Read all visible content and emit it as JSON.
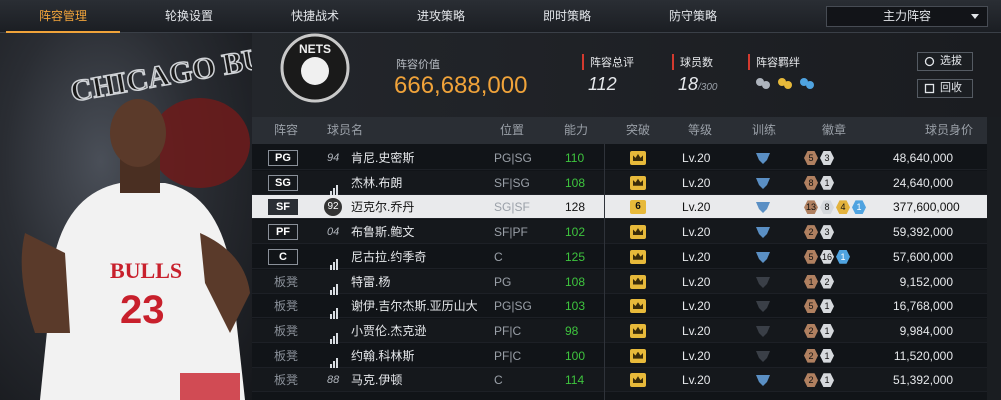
{
  "tabs": [
    "阵容管理",
    "轮换设置",
    "快捷战术",
    "进攻策略",
    "即时策略",
    "防守策略"
  ],
  "lineup_select": "主力阵容",
  "art": {
    "team_text": "CHICAGO BULLS",
    "jersey_text": "BULLS",
    "jersey_number": "23"
  },
  "team_logo_text": "NETS",
  "roster_value": {
    "label": "阵容价值",
    "value": "666,688,000"
  },
  "stats": [
    {
      "label": "阵容总评",
      "value": "112",
      "sub": ""
    },
    {
      "label": "球员数",
      "value": "18",
      "sub": "/300"
    },
    {
      "label": "阵容羁绊",
      "value": "",
      "sub": ""
    }
  ],
  "buttons": {
    "pick": "选拔",
    "back": "回收"
  },
  "colors": {
    "accent": "#f0a33a",
    "ability": "#3ec43e",
    "selected_row": "#e9eaec",
    "stat_bar": "#d33a2f"
  },
  "columns": [
    "阵容",
    "球员名",
    "位置",
    "能力",
    "突破",
    "等级",
    "训练",
    "徽章",
    "球员身价"
  ],
  "players": [
    {
      "slot": "PG",
      "bench": false,
      "jersey": "94",
      "name": "肯尼.史密斯",
      "position": "PG|SG",
      "ability": "110",
      "breakthrough": "",
      "level": "Lv.20",
      "medals": [
        {
          "c": "bronze",
          "n": "5"
        },
        {
          "c": "silver",
          "n": "3"
        }
      ],
      "value": "48,640,000"
    },
    {
      "slot": "SG",
      "bench": false,
      "jersey": "",
      "name": "杰林.布朗",
      "position": "SF|SG",
      "ability": "108",
      "breakthrough": "",
      "level": "Lv.20",
      "medals": [
        {
          "c": "bronze",
          "n": "8"
        },
        {
          "c": "silver",
          "n": "1"
        }
      ],
      "value": "24,640,000"
    },
    {
      "slot": "SF",
      "bench": false,
      "jersey": "92",
      "name": "迈克尔.乔丹",
      "position": "SG|SF",
      "ability": "128",
      "breakthrough": "6",
      "level": "Lv.20",
      "medals": [
        {
          "c": "bronze",
          "n": "13"
        },
        {
          "c": "silver",
          "n": "8"
        },
        {
          "c": "gold",
          "n": "4"
        },
        {
          "c": "blue",
          "n": "1"
        }
      ],
      "value": "377,600,000"
    },
    {
      "slot": "PF",
      "bench": false,
      "jersey": "04",
      "name": "布鲁斯.鲍文",
      "position": "SF|PF",
      "ability": "102",
      "breakthrough": "",
      "level": "Lv.20",
      "medals": [
        {
          "c": "bronze",
          "n": "2"
        },
        {
          "c": "silver",
          "n": "3"
        }
      ],
      "value": "59,392,000"
    },
    {
      "slot": "C",
      "bench": false,
      "jersey": "",
      "name": "尼古拉.约季奇",
      "position": "C",
      "ability": "125",
      "breakthrough": "",
      "level": "Lv.20",
      "medals": [
        {
          "c": "bronze",
          "n": "5"
        },
        {
          "c": "silver",
          "n": "16"
        },
        {
          "c": "blue",
          "n": "1"
        }
      ],
      "value": "57,600,000"
    },
    {
      "slot": "板凳",
      "bench": true,
      "jersey": "",
      "name": "特雷.杨",
      "position": "PG",
      "ability": "108",
      "breakthrough": "",
      "level": "Lv.20",
      "medals": [
        {
          "c": "bronze",
          "n": "1"
        },
        {
          "c": "silver",
          "n": "2"
        }
      ],
      "value": "9,152,000"
    },
    {
      "slot": "板凳",
      "bench": true,
      "jersey": "",
      "name": "谢伊.吉尔杰斯.亚历山大",
      "position": "PG|SG",
      "ability": "103",
      "breakthrough": "",
      "level": "Lv.20",
      "medals": [
        {
          "c": "bronze",
          "n": "5"
        },
        {
          "c": "silver",
          "n": "1"
        }
      ],
      "value": "16,768,000"
    },
    {
      "slot": "板凳",
      "bench": true,
      "jersey": "",
      "name": "小贾伦.杰克逊",
      "position": "PF|C",
      "ability": "98",
      "breakthrough": "",
      "level": "Lv.20",
      "medals": [
        {
          "c": "bronze",
          "n": "2"
        },
        {
          "c": "silver",
          "n": "1"
        }
      ],
      "value": "9,984,000"
    },
    {
      "slot": "板凳",
      "bench": true,
      "jersey": "",
      "name": "约翰.科林斯",
      "position": "PF|C",
      "ability": "100",
      "breakthrough": "",
      "level": "Lv.20",
      "medals": [
        {
          "c": "bronze",
          "n": "2"
        },
        {
          "c": "silver",
          "n": "1"
        }
      ],
      "value": "11,520,000"
    },
    {
      "slot": "板凳",
      "bench": true,
      "jersey": "88",
      "name": "马克.伊顿",
      "position": "C",
      "ability": "114",
      "breakthrough": "",
      "level": "Lv.20",
      "medals": [
        {
          "c": "bronze",
          "n": "2"
        },
        {
          "c": "silver",
          "n": "1"
        }
      ],
      "value": "51,392,000"
    }
  ]
}
